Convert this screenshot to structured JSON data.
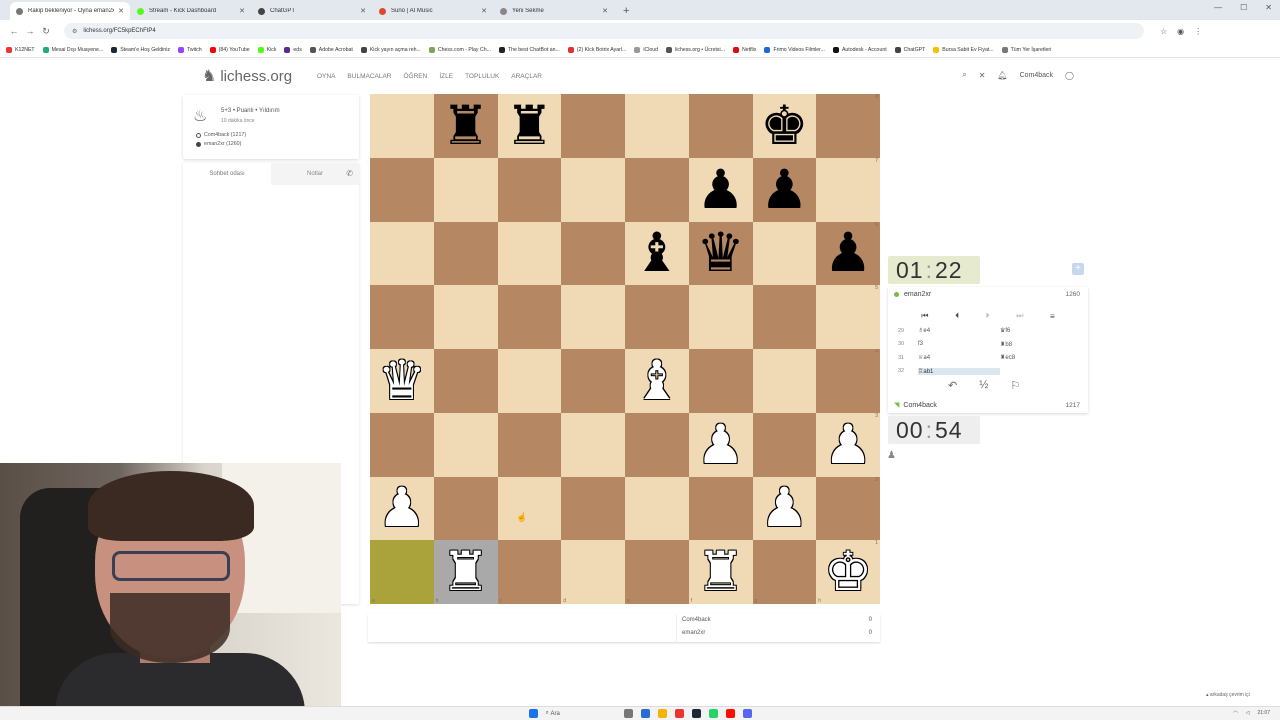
{
  "browser": {
    "tabs": [
      {
        "label": "Rakip bekleniyor - Oyna eman2xr",
        "active": true,
        "color": "#777777"
      },
      {
        "label": "Stream - Kick Dashboard",
        "active": false,
        "color": "#53fc18"
      },
      {
        "label": "ChatGPT",
        "active": false,
        "color": "#444444"
      },
      {
        "label": "Suno | AI Music",
        "active": false,
        "color": "#e0482b"
      },
      {
        "label": "Yeni Sekme",
        "active": false,
        "color": "#888888"
      }
    ],
    "url": "lichess.org/FC5kpEChFtP4",
    "bookmarks": [
      {
        "label": "K12NET",
        "color": "#e33"
      },
      {
        "label": "Mesai Dışı Muayene...",
        "color": "#2a7"
      },
      {
        "label": "Steam'e Hoş Geldiniz",
        "color": "#1b2838"
      },
      {
        "label": "Twitch",
        "color": "#9146ff"
      },
      {
        "label": "(84) YouTube",
        "color": "#f00"
      },
      {
        "label": "Kick",
        "color": "#53fc18"
      },
      {
        "label": "eds",
        "color": "#5b2c8f"
      },
      {
        "label": "Adobe Acrobat",
        "color": "#555"
      },
      {
        "label": "Kick yayın açma reh...",
        "color": "#444"
      },
      {
        "label": "Chess.com - Play Ch...",
        "color": "#7fa650"
      },
      {
        "label": "The best ChatBot an...",
        "color": "#222"
      },
      {
        "label": "(2) Kick Botrix Ayarl...",
        "color": "#d33"
      },
      {
        "label": "iCloud",
        "color": "#999"
      },
      {
        "label": "lichess.org • Ücretsi...",
        "color": "#555"
      },
      {
        "label": "Netflix",
        "color": "#e50914"
      },
      {
        "label": "Frimo Videos Filmler...",
        "color": "#1a6ad8"
      },
      {
        "label": "Autodesk - Account",
        "color": "#111"
      },
      {
        "label": "ChatGPT",
        "color": "#444"
      },
      {
        "label": "Bursa Sabit Ev Fiyat...",
        "color": "#f2c200"
      },
      {
        "label": "Tüm Yer İşaretleri",
        "color": "#777"
      }
    ]
  },
  "site": {
    "logo": "lichess.org",
    "nav": [
      "OYNA",
      "BULMACALAR",
      "ÖĞREN",
      "İZLE",
      "TOPLULUK",
      "ARAÇLAR"
    ],
    "user": "Com4back"
  },
  "game": {
    "title": "5+3 • Puanlı • Yıldırım",
    "time_ago": "10 dakika önce",
    "white": "Com4back (1217)",
    "black": "eman2xr (1260)"
  },
  "chat": {
    "tab_chat": "Sohbet odası",
    "tab_notes": "Notlar"
  },
  "board": {
    "ranks": [
      [
        "",
        "br",
        "br",
        "",
        "",
        "",
        "bk",
        ""
      ],
      [
        "",
        "",
        "",
        "",
        "",
        "bp",
        "bp",
        ""
      ],
      [
        "",
        "",
        "",
        "",
        "bb",
        "bq",
        "",
        "bp"
      ],
      [
        "",
        "",
        "",
        "",
        "",
        "",
        "",
        ""
      ],
      [
        "wq",
        "",
        "",
        "",
        "wb",
        "",
        "",
        ""
      ],
      [
        "",
        "",
        "",
        "",
        "",
        "wp",
        "",
        "wp"
      ],
      [
        "wp",
        "",
        "",
        "",
        "",
        "",
        "wp",
        ""
      ],
      [
        "",
        "wr",
        "",
        "",
        "",
        "wr",
        "",
        "wk"
      ]
    ],
    "highlight_from": "a1",
    "highlight_to": "b1",
    "check": "",
    "files": [
      "a",
      "b",
      "c",
      "d",
      "e",
      "f",
      "g",
      "h"
    ],
    "rank_labels": [
      "8",
      "7",
      "6",
      "5",
      "4",
      "3",
      "2",
      "1"
    ]
  },
  "opponent": {
    "name": "eman2xr",
    "rating": "1260",
    "clock_min": "01",
    "clock_sec": "22"
  },
  "player": {
    "name": "Com4back",
    "rating": "1217",
    "clock_min": "00",
    "clock_sec": "54"
  },
  "moves": [
    {
      "n": "29",
      "w": "♗e4",
      "b": "♛f6"
    },
    {
      "n": "30",
      "w": "f3",
      "b": "♜b8"
    },
    {
      "n": "31",
      "w": "♕a4",
      "b": "♜ec8"
    },
    {
      "n": "32",
      "w": "♖ab1",
      "b": ""
    }
  ],
  "score": {
    "white": "Com4back",
    "white_score": "0",
    "black": "eman2xr",
    "black_score": "0"
  },
  "taskbar": {
    "search": "Ara",
    "tray": "21:07",
    "toast": "arkadaş çevrim içi"
  }
}
